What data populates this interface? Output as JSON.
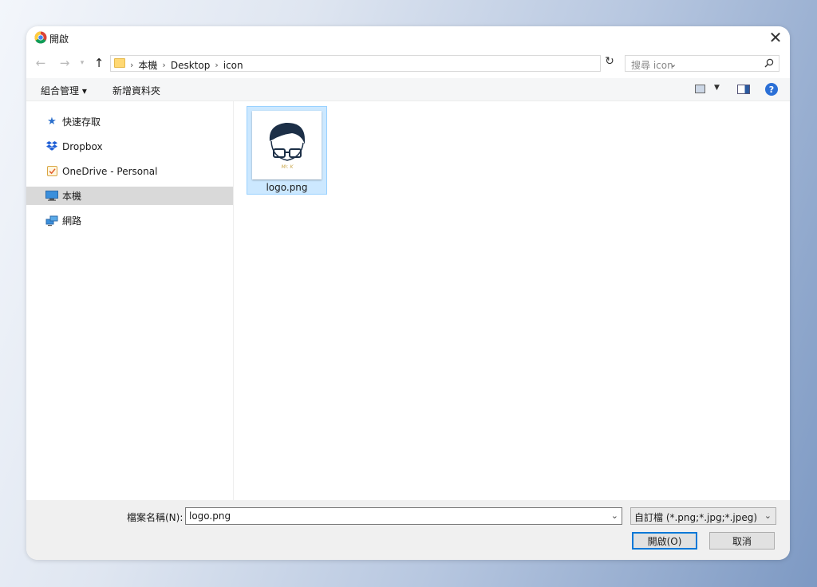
{
  "window": {
    "title": "開啟"
  },
  "address_bar": {
    "crumbs": [
      "本機",
      "Desktop",
      "icon"
    ],
    "separator": "›"
  },
  "search": {
    "placeholder": "搜尋 icon"
  },
  "toolbar": {
    "organize_label": "組合管理 ▾",
    "new_folder_label": "新增資料夾"
  },
  "sidebar": {
    "items": [
      {
        "label": "快速存取",
        "icon": "star-icon"
      },
      {
        "label": "Dropbox",
        "icon": "dropbox-icon"
      },
      {
        "label": "OneDrive - Personal",
        "icon": "onedrive-icon"
      },
      {
        "label": "本機",
        "icon": "computer-icon",
        "selected": true
      },
      {
        "label": "網路",
        "icon": "network-icon"
      }
    ]
  },
  "files": [
    {
      "name": "logo.png",
      "thumbnail_text": "Mr. K",
      "selected": true
    }
  ],
  "footer": {
    "filename_label": "檔案名稱(N):",
    "filename_value": "logo.png",
    "filetype_value": "自訂檔 (*.png;*.jpg;*.jpeg)",
    "open_label": "開啟(O)",
    "cancel_label": "取消"
  },
  "colors": {
    "selection_bg": "#cce8ff",
    "selection_border": "#99d1ff",
    "accent": "#0078d7"
  }
}
